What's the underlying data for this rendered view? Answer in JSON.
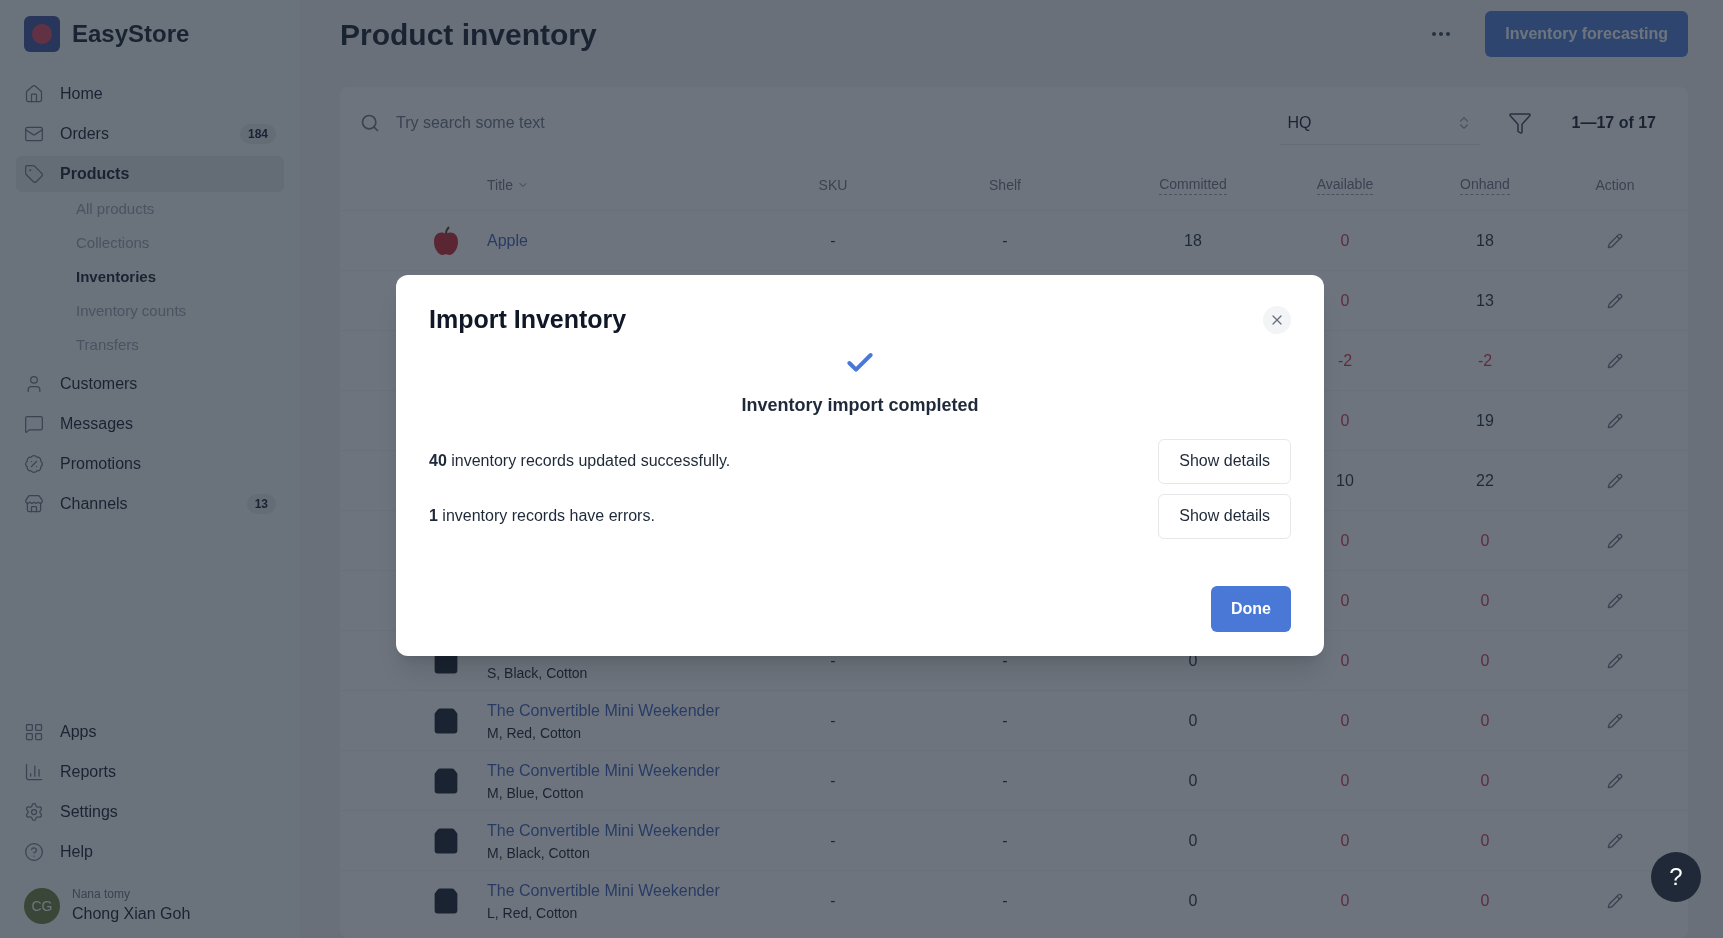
{
  "sidebar": {
    "brand": "EasyStore",
    "nav": [
      {
        "label": "Home",
        "selected": false
      },
      {
        "label": "Orders",
        "badge": "184",
        "selected": false
      },
      {
        "label": "Products",
        "selected": true,
        "children": [
          {
            "label": "All products",
            "selected": false
          },
          {
            "label": "Collections",
            "selected": false
          },
          {
            "label": "Inventories",
            "selected": true
          },
          {
            "label": "Inventory counts",
            "selected": false
          },
          {
            "label": "Transfers",
            "selected": false
          }
        ]
      },
      {
        "label": "Customers",
        "selected": false
      },
      {
        "label": "Messages",
        "selected": false
      },
      {
        "label": "Promotions",
        "selected": false
      },
      {
        "label": "Channels",
        "badge": "13",
        "selected": false
      }
    ],
    "bottom_nav": [
      "Apps",
      "Reports",
      "Settings",
      "Help"
    ],
    "user": {
      "initials": "CG",
      "store": "Nana tomy",
      "name": "Chong Xian Goh"
    }
  },
  "header": {
    "title": "Product inventory",
    "primary_button": "Inventory forecasting"
  },
  "toolbar": {
    "search_placeholder": "Try search some text",
    "location": "HQ",
    "count": "1—17 of 17"
  },
  "table": {
    "columns": [
      "Title",
      "SKU",
      "Shelf",
      "Committed",
      "Available",
      "Onhand",
      "Action"
    ],
    "rows": [
      {
        "kind": "apple",
        "title": "Apple",
        "sku": "-",
        "shelf": "-",
        "committed": "18",
        "available": "0",
        "onhand": "18"
      },
      {
        "available": "0",
        "onhand": "13"
      },
      {
        "available": "-2",
        "onhand": "-2"
      },
      {
        "available": "0",
        "onhand": "19"
      },
      {
        "available": "10",
        "onhand": "22"
      },
      {
        "available": "0",
        "onhand": "0"
      },
      {
        "available": "0",
        "onhand": "0"
      },
      {
        "kind": "bag",
        "variant": "S, Black, Cotton",
        "sku": "-",
        "shelf": "-",
        "committed": "0",
        "available": "0",
        "onhand": "0"
      },
      {
        "kind": "bag",
        "title": "The Convertible Mini Weekender",
        "variant": "M, Red, Cotton",
        "sku": "-",
        "shelf": "-",
        "committed": "0",
        "available": "0",
        "onhand": "0"
      },
      {
        "kind": "bag",
        "title": "The Convertible Mini Weekender",
        "variant": "M, Blue, Cotton",
        "sku": "-",
        "shelf": "-",
        "committed": "0",
        "available": "0",
        "onhand": "0"
      },
      {
        "kind": "bag",
        "title": "The Convertible Mini Weekender",
        "variant": "M, Black, Cotton",
        "sku": "-",
        "shelf": "-",
        "committed": "0",
        "available": "0",
        "onhand": "0"
      },
      {
        "kind": "bag",
        "title": "The Convertible Mini Weekender",
        "variant": "L, Red, Cotton",
        "sku": "-",
        "shelf": "-",
        "committed": "0",
        "available": "0",
        "onhand": "0"
      }
    ]
  },
  "dialog": {
    "title": "Import Inventory",
    "status": "Inventory import completed",
    "results": [
      {
        "text": "**40** inventory records updated successfully.",
        "button": "Show details"
      },
      {
        "text": "**1** inventory records have errors.",
        "button": "Show details"
      }
    ],
    "done_button": "Done"
  },
  "help_button": "?"
}
